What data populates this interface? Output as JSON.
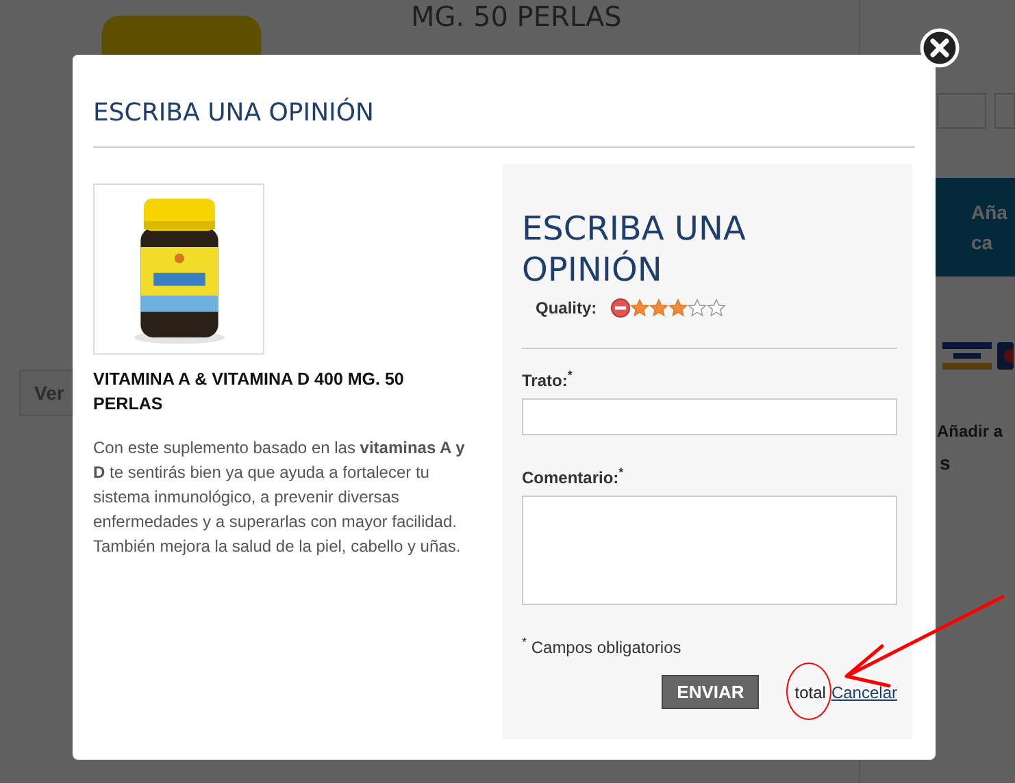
{
  "background": {
    "product_title": "MG. 50 PERLAS",
    "view_button": "Ver",
    "cart_button": "Aña\nca",
    "add_link": "Añadir a",
    "side_text": "s"
  },
  "modal": {
    "title": "ESCRIBA UNA OPINIÓN",
    "product": {
      "name": "VITAMINA A & VITAMINA D 400 MG. 50 PERLAS",
      "description": "Con este suplemento basado en las **vitaminas A y D** te sentirás bien ya que ayuda a fortalecer tu sistema inmunológico, a prevenir diversas enfermedades y a superarlas con mayor facilidad. También mejora la salud de la piel, cabello y uñas."
    },
    "form": {
      "title": "ESCRIBA UNA OPINIÓN",
      "quality_label": "Quality:",
      "stars": 3,
      "fields": [
        {
          "kind": "input",
          "label": "Trato:$^{*}$"
        },
        {
          "kind": "textarea",
          "label": "Comentario:$^{*}$"
        }
      ],
      "required_note": "$^{*}$ Campos obligatorios",
      "submit": "ENVIAR",
      "total": "total",
      "cancel": "Cancelar"
    }
  }
}
